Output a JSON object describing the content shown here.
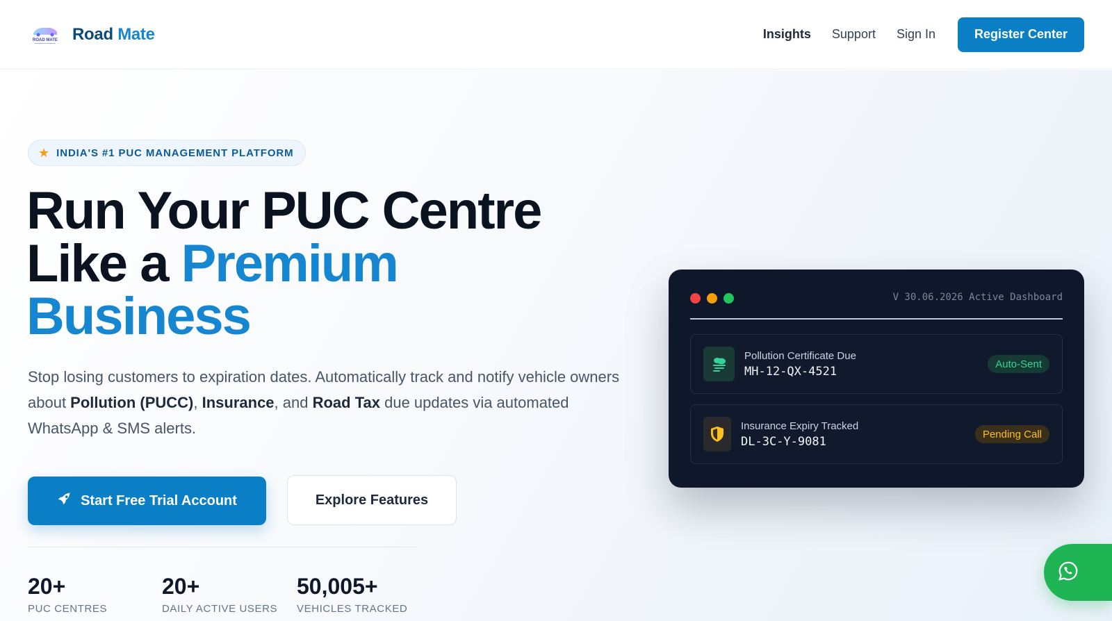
{
  "header": {
    "brand_part1": "Road",
    "brand_part2": "Mate",
    "logo_text": "ROAD MATE",
    "nav": [
      {
        "label": "Insights",
        "active": true
      },
      {
        "label": "Support",
        "active": false
      },
      {
        "label": "Sign In",
        "active": false
      }
    ],
    "cta_label": "Register Center"
  },
  "hero": {
    "badge_icon": "star-icon",
    "badge_text": "INDIA'S #1 PUC MANAGEMENT PLATFORM",
    "headline_line1": "Run Your PUC Centre",
    "headline_line2_plain": "Like a ",
    "headline_line2_accent": "Premium",
    "headline_line3_accent": "Business",
    "desc_part1": "Stop losing customers to expiration dates. Automatically track and notify vehicle owners about ",
    "desc_bold1": "Pollution (PUCC)",
    "desc_part2": ", ",
    "desc_bold2": "Insurance",
    "desc_part3": ", and ",
    "desc_bold3": "Road Tax",
    "desc_part4": " due updates via automated WhatsApp & SMS alerts.",
    "primary_cta": "Start Free Trial Account",
    "secondary_cta": "Explore Features"
  },
  "stats": [
    {
      "value": "20+",
      "label": "PUC CENTRES"
    },
    {
      "value": "20+",
      "label": "DAILY ACTIVE USERS"
    },
    {
      "value": "50,005+",
      "label": "VEHICLES TRACKED"
    }
  ],
  "dashboard": {
    "title": "V 30.06.2026 Active Dashboard",
    "rows": [
      {
        "icon": "smog-icon",
        "label": "Pollution Certificate Due",
        "code": "MH-12-QX-4521",
        "status": "Auto-Sent"
      },
      {
        "icon": "shield-icon",
        "label": "Insurance Expiry Tracked",
        "code": "DL-3C-Y-9081",
        "status": "Pending Call"
      }
    ]
  },
  "colors": {
    "primary": "#0a7fc6",
    "accent_text": "#1586cf",
    "dark_card": "#0f172a",
    "dot_red": "#ef4444",
    "dot_yellow": "#f59e0b",
    "dot_green": "#22c55e",
    "status_green": "#34d399",
    "status_amber": "#fbbf24",
    "whatsapp": "#1fb454"
  },
  "floating": {
    "icon": "whatsapp-icon"
  }
}
